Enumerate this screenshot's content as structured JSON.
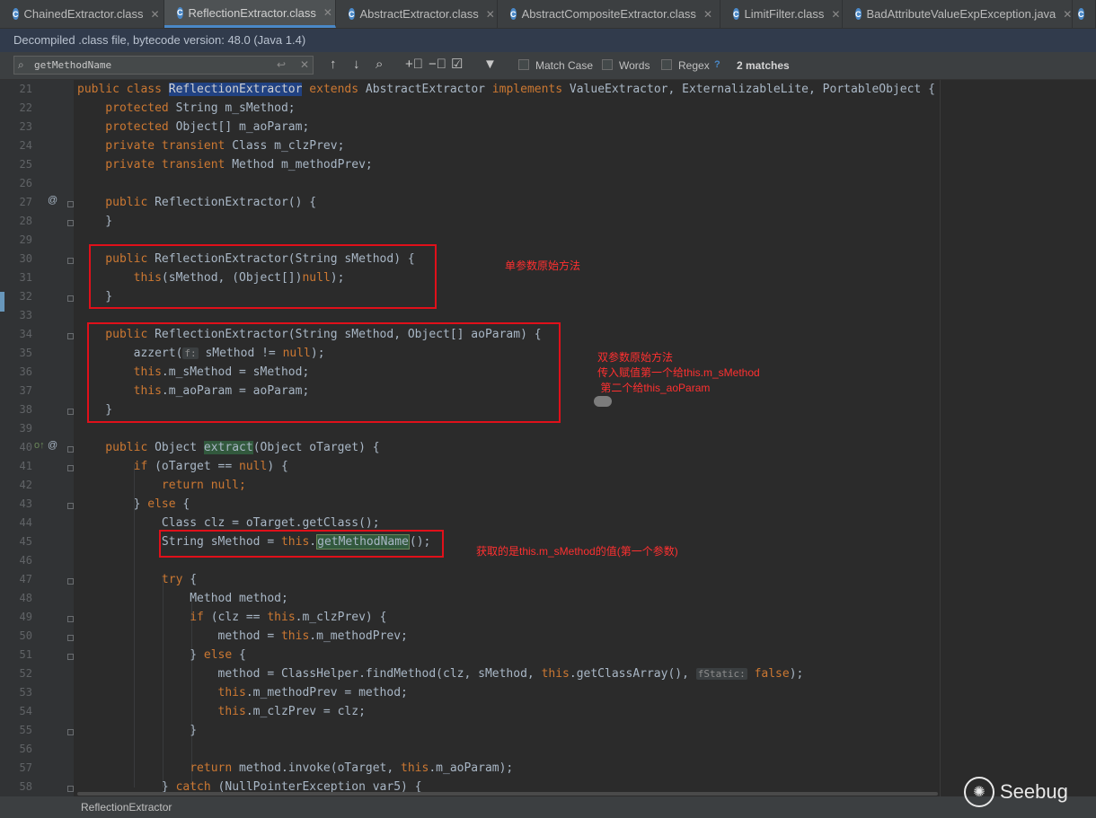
{
  "tabs": [
    {
      "label": "ChainedExtractor.class",
      "active": false
    },
    {
      "label": "ReflectionExtractor.class",
      "active": true
    },
    {
      "label": "AbstractExtractor.class",
      "active": false
    },
    {
      "label": "AbstractCompositeExtractor.class",
      "active": false
    },
    {
      "label": "LimitFilter.class",
      "active": false
    },
    {
      "label": "BadAttributeValueExpException.java",
      "active": false
    },
    {
      "label": "",
      "active": false
    }
  ],
  "banner": "Decompiled .class file, bytecode version: 48.0 (Java 1.4)",
  "search": {
    "value": "getMethodName",
    "match_case_label": "Match Case",
    "words_label": "Words",
    "regex_label": "Regex",
    "help": "?",
    "matches": "2 matches"
  },
  "lines": [
    "21",
    "22",
    "23",
    "24",
    "25",
    "26",
    "27",
    "28",
    "29",
    "30",
    "31",
    "32",
    "33",
    "34",
    "35",
    "36",
    "37",
    "38",
    "39",
    "40",
    "41",
    "42",
    "43",
    "44",
    "45",
    "46",
    "47",
    "48",
    "49",
    "50",
    "51",
    "52",
    "53",
    "54",
    "55",
    "56",
    "57",
    "58"
  ],
  "code": {
    "l21": {
      "a": "public class ",
      "b": "ReflectionExtractor",
      "c": " extends ",
      "d": "AbstractExtractor",
      "e": " implements ",
      "f": "ValueExtractor, ExternalizableLite, PortableObject {"
    },
    "l22": {
      "a": "    protected ",
      "b": "String m_sMethod;"
    },
    "l23": {
      "a": "    protected ",
      "b": "Object[] m_aoParam;"
    },
    "l24": {
      "a": "    private transient ",
      "b": "Class m_clzPrev;"
    },
    "l25": {
      "a": "    private transient ",
      "b": "Method m_methodPrev;"
    },
    "l27": {
      "a": "    public ",
      "b": "ReflectionExtractor() {"
    },
    "l28": {
      "a": "    }"
    },
    "l30": {
      "a": "    public ",
      "b": "ReflectionExtractor(String sMethod) {"
    },
    "l31": {
      "a": "        this",
      "b": "(sMethod, (Object[])",
      "c": "null",
      "d": ");"
    },
    "l32": {
      "a": "    }"
    },
    "l34": {
      "a": "    public ",
      "b": "ReflectionExtractor(String sMethod, Object[] aoParam) {"
    },
    "l35": {
      "a": "        azzert(",
      "hint": "f:",
      "b": " sMethod != ",
      "c": "null",
      "d": ");"
    },
    "l36": {
      "a": "        this",
      "b": ".m_sMethod = sMethod;"
    },
    "l37": {
      "a": "        this",
      "b": ".m_aoParam = aoParam;"
    },
    "l38": {
      "a": "    }"
    },
    "l40": {
      "a": "    public ",
      "b": "Object ",
      "c": "extract",
      "d": "(Object oTarget) {"
    },
    "l41": {
      "a": "        if ",
      "b": "(oTarget == ",
      "c": "null",
      "d": ") {"
    },
    "l42": {
      "a": "            return null;"
    },
    "l43": {
      "a": "        } ",
      "b": "else ",
      "c": "{"
    },
    "l44": {
      "a": "            Class clz = oTarget.getClass();"
    },
    "l45": {
      "a": "            String sMethod = ",
      "b": "this",
      "c": ".",
      "d": "getMethodName",
      "e": "();"
    },
    "l47": {
      "a": "            try ",
      "b": "{"
    },
    "l48": {
      "a": "                Method method;"
    },
    "l49": {
      "a": "                if ",
      "b": "(clz == ",
      "c": "this",
      "d": ".m_clzPrev) {"
    },
    "l50": {
      "a": "                    method = ",
      "b": "this",
      "c": ".m_methodPrev;"
    },
    "l51": {
      "a": "                } ",
      "b": "else ",
      "c": "{"
    },
    "l52": {
      "a": "                    method = ClassHelper.findMethod(clz, sMethod, ",
      "b": "this",
      "c": ".getClassArray(), ",
      "hint": "fStatic:",
      "d": " false",
      "e": ");"
    },
    "l53": {
      "a": "                    this",
      "b": ".m_methodPrev = method;"
    },
    "l54": {
      "a": "                    this",
      "b": ".m_clzPrev = clz;"
    },
    "l55": {
      "a": "                }"
    },
    "l57": {
      "a": "                return ",
      "b": "method.invoke(oTarget, ",
      "c": "this",
      "d": ".m_aoParam);"
    },
    "l58": {
      "a": "            } ",
      "b": "catch ",
      "c": "(NullPointerException var5) {"
    }
  },
  "annotations": {
    "a1": "单参数原始方法",
    "a2_1": "双参数原始方法",
    "a2_2": "传入赋值第一个给this.m_sMethod",
    "a2_3": " 第二个给this_aoParam",
    "a3": "获取的是this.m_sMethod的值(第一个参数)"
  },
  "status": "ReflectionExtractor",
  "watermark": "Seebug",
  "colors": {
    "keyword": "#cc7832",
    "annotation": "#ff3030",
    "box": "#e0101a"
  }
}
